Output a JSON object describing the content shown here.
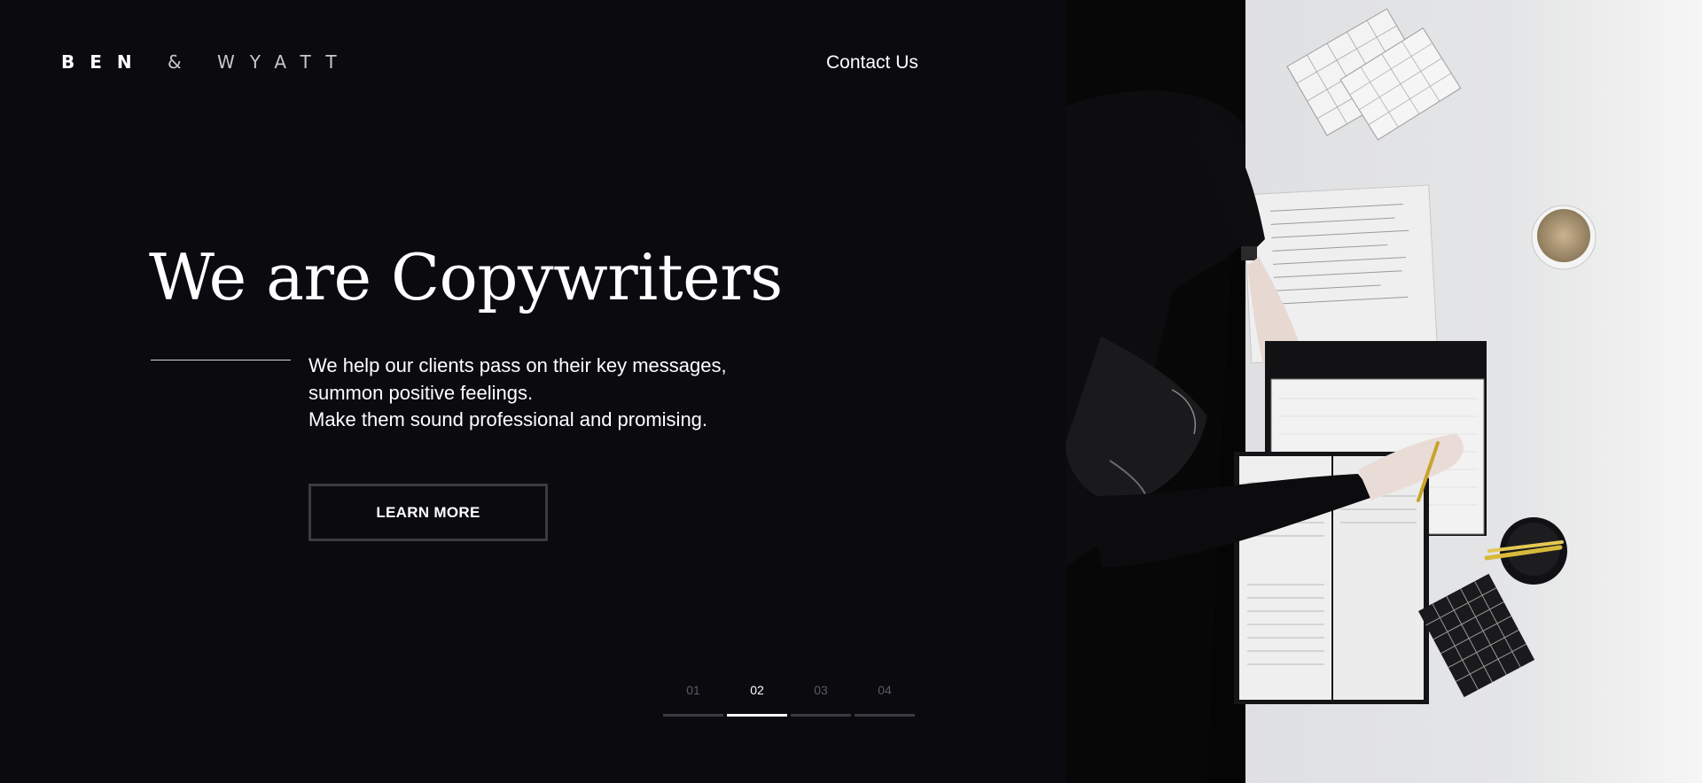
{
  "brand": {
    "word1": "BEN",
    "amp": "&",
    "word2": "WYATT"
  },
  "nav": {
    "contact_label": "Contact Us"
  },
  "hero": {
    "title": "We are Copywriters",
    "description_lines": [
      "We help our clients pass on their key messages,",
      "summon positive feelings.",
      "Make them sound professional and promising."
    ],
    "cta_label": "LEARN MORE"
  },
  "slider": {
    "pages": [
      "01",
      "02",
      "03",
      "04"
    ],
    "active_index": 1
  },
  "colors": {
    "background": "#0a0a0f",
    "text": "#ffffff",
    "muted": "#5a5a62",
    "button_border": "#3b3b40"
  },
  "image": {
    "description_icon": "desk-writing-photo"
  }
}
